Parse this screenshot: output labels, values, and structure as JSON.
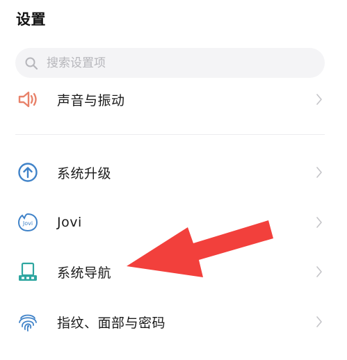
{
  "header": {
    "title": "设置"
  },
  "search": {
    "placeholder": "搜索设置项",
    "value": ""
  },
  "settings": {
    "items": [
      {
        "label": "声音与振动",
        "icon": "speaker-icon",
        "color": "#e8826a"
      },
      {
        "label": "系统升级",
        "icon": "upgrade-arrow-icon",
        "color": "#3f82c8"
      },
      {
        "label": "Jovi",
        "icon": "jovi-icon",
        "color": "#3f82c8"
      },
      {
        "label": "系统导航",
        "icon": "navigation-icon",
        "color": "#2ea6a0"
      },
      {
        "label": "指纹、面部与密码",
        "icon": "fingerprint-icon",
        "color": "#3f82c8"
      }
    ]
  },
  "annotation": {
    "color": "#f2403c",
    "icon": "red-arrow-annotation"
  }
}
